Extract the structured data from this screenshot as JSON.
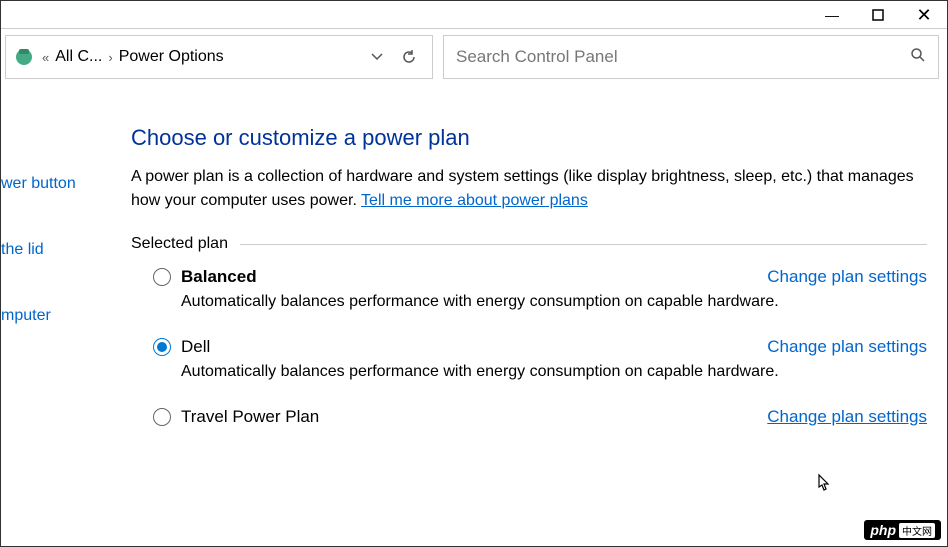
{
  "titlebar": {
    "minimize": "—",
    "maximize": "▭",
    "close": "✕"
  },
  "breadcrumb": {
    "back_hint": "«",
    "crumb1": "All C...",
    "sep": "›",
    "crumb2": "Power Options"
  },
  "search": {
    "placeholder": "Search Control Panel"
  },
  "sidebar": {
    "items": [
      {
        "label": "wer button"
      },
      {
        "label": "the lid"
      },
      {
        "label": "mputer"
      }
    ]
  },
  "main": {
    "heading": "Choose or customize a power plan",
    "desc_pre": "A power plan is a collection of hardware and system settings (like display brightness, sleep, etc.) that manages how your computer uses power. ",
    "desc_link": "Tell me more about power plans",
    "section": "Selected plan",
    "change_label": "Change plan settings",
    "plans": [
      {
        "name": "Balanced",
        "bold": true,
        "selected": false,
        "desc": "Automatically balances performance with energy consumption on capable hardware."
      },
      {
        "name": "Dell",
        "bold": false,
        "selected": true,
        "desc": "Automatically balances performance with energy consumption on capable hardware."
      },
      {
        "name": "Travel Power Plan",
        "bold": false,
        "selected": false,
        "desc": ""
      }
    ]
  },
  "watermark": {
    "left": "php",
    "right": "中文网"
  }
}
